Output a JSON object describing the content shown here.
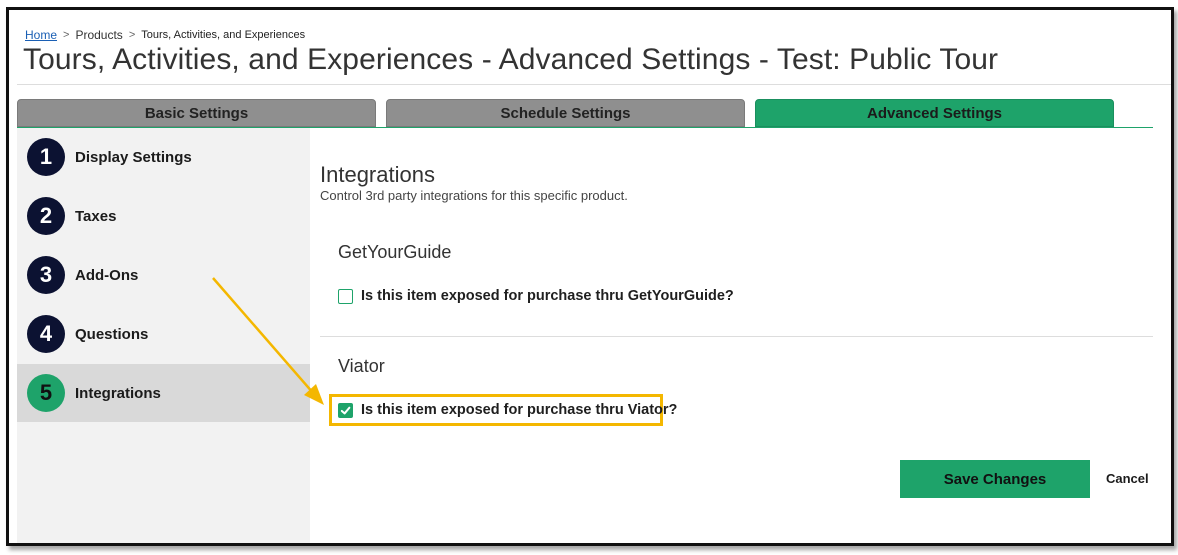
{
  "breadcrumb": {
    "home": "Home",
    "separator": ">",
    "products": "Products",
    "current": "Tours, Activities, and Experiences"
  },
  "page_title": "Tours, Activities, and Experiences - Advanced Settings - Test: Public Tour",
  "tabs": [
    {
      "label": "Basic Settings",
      "active": false
    },
    {
      "label": "Schedule Settings",
      "active": false
    },
    {
      "label": "Advanced Settings",
      "active": true
    }
  ],
  "sidebar": {
    "steps": [
      {
        "num": "1",
        "label": "Display Settings",
        "active": false
      },
      {
        "num": "2",
        "label": "Taxes",
        "active": false
      },
      {
        "num": "3",
        "label": "Add-Ons",
        "active": false
      },
      {
        "num": "4",
        "label": "Questions",
        "active": false
      },
      {
        "num": "5",
        "label": "Integrations",
        "active": true
      }
    ]
  },
  "content": {
    "title": "Integrations",
    "description": "Control 3rd party integrations for this specific product.",
    "getyourguide": {
      "title": "GetYourGuide",
      "checkbox_label": "Is this item exposed for purchase thru GetYourGuide?",
      "checked": false
    },
    "viator": {
      "title": "Viator",
      "checkbox_label": "Is this item exposed for purchase thru Viator?",
      "checked": true
    },
    "save_label": "Save Changes",
    "cancel_label": "Cancel"
  },
  "colors": {
    "accent": "#1ea36a",
    "step_circle": "#0c1232",
    "highlight": "#f4b700",
    "tab_inactive": "#8f8f8f"
  },
  "icons": {
    "checkmark": "check-icon",
    "annotation": "arrow-icon"
  }
}
